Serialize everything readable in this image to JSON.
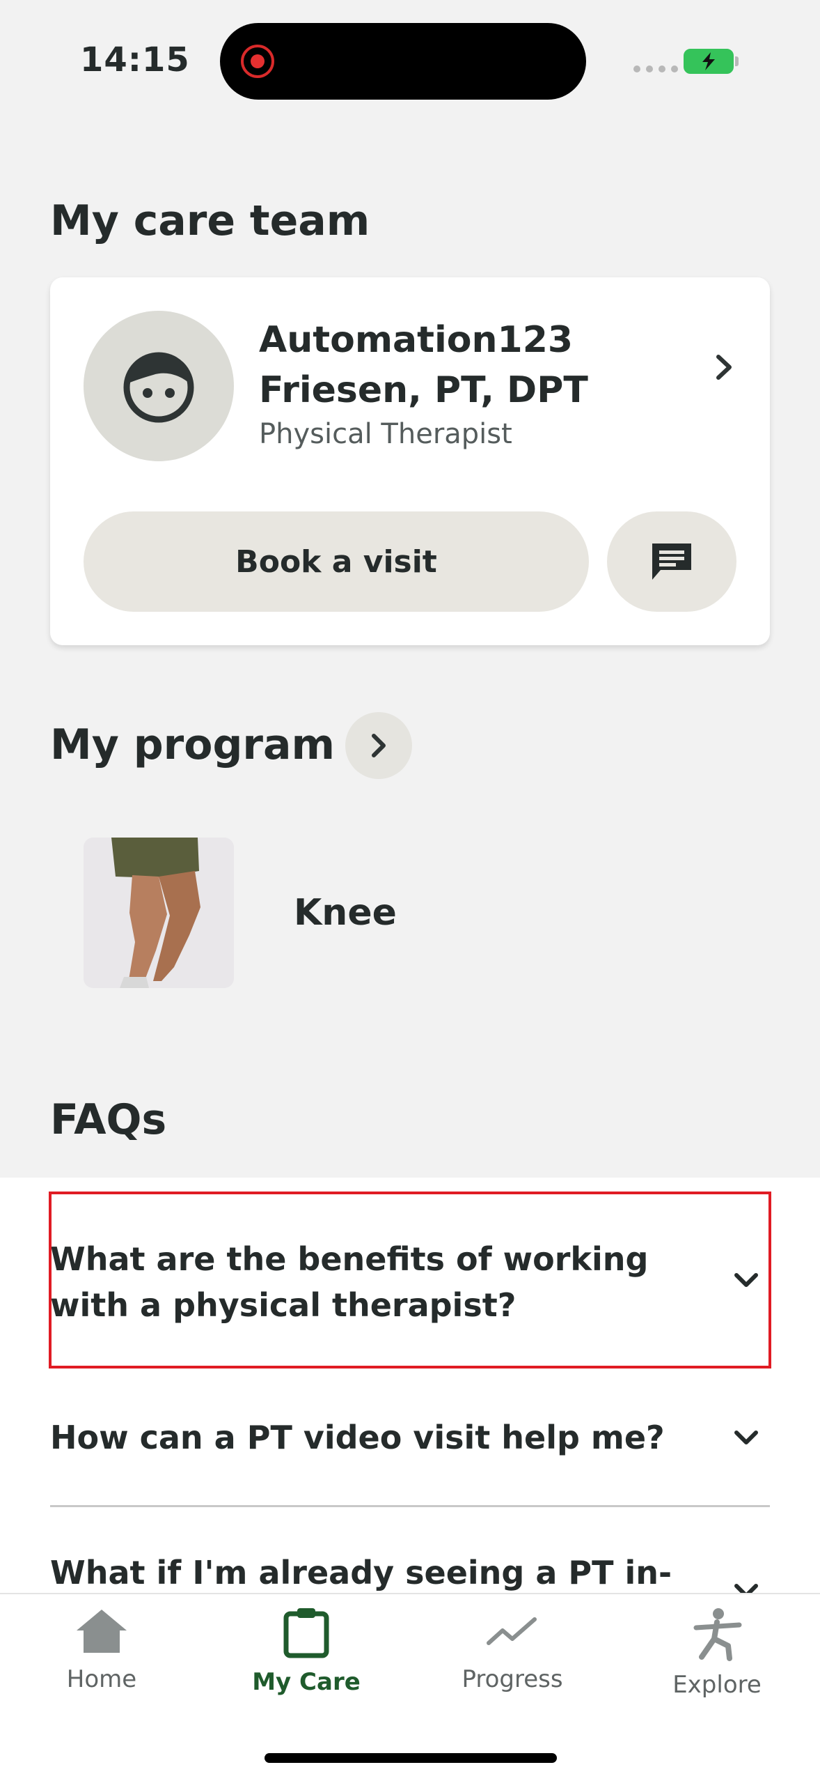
{
  "status_bar": {
    "time": "14:15"
  },
  "care_team": {
    "title": "My care team",
    "provider_name": "Automation123 Friesen, PT, DPT",
    "provider_role": "Physical Therapist",
    "book_label": "Book a visit"
  },
  "program": {
    "title": "My program",
    "item_label": "Knee"
  },
  "faqs": {
    "title": "FAQs",
    "questions": [
      "What are the benefits of working with a physical therapist?",
      "How can a PT video visit help me?",
      "What if I'm already seeing a PT in-"
    ]
  },
  "tabs": [
    {
      "label": "Home"
    },
    {
      "label": "My Care"
    },
    {
      "label": "Progress"
    },
    {
      "label": "Explore"
    }
  ],
  "colors": {
    "accent": "#1f5b2c",
    "highlight": "#e01c24",
    "battery": "#35c35a"
  }
}
